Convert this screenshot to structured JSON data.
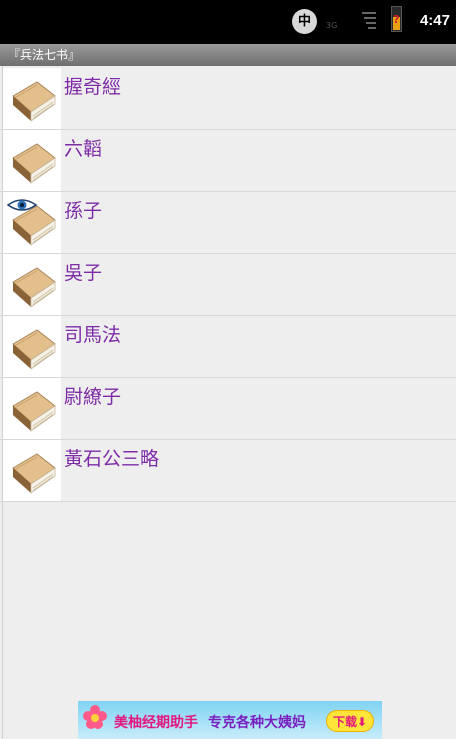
{
  "status_bar": {
    "ime_label": "中",
    "network_label": "3G",
    "time": "4:47",
    "icons": [
      "ime-icon",
      "signal-icon",
      "battery-warning-icon"
    ]
  },
  "header": {
    "title": "『兵法七书』"
  },
  "books": [
    {
      "title": "握奇經",
      "icon": "book-icon",
      "viewed": false
    },
    {
      "title": "六韜",
      "icon": "book-icon",
      "viewed": false
    },
    {
      "title": "孫子",
      "icon": "book-icon",
      "viewed": true
    },
    {
      "title": "吳子",
      "icon": "book-icon",
      "viewed": false
    },
    {
      "title": "司馬法",
      "icon": "book-icon",
      "viewed": false
    },
    {
      "title": "尉繚子",
      "icon": "book-icon",
      "viewed": false
    },
    {
      "title": "黃石公三略",
      "icon": "book-icon",
      "viewed": false
    }
  ],
  "ad": {
    "text": "美柚经期助手",
    "subtext": "专克各种大姨妈",
    "button_label": "下载"
  },
  "colors": {
    "title_text": "#7d2ba6",
    "status_bar_bg": "#000000",
    "background": "#eeeeee"
  }
}
